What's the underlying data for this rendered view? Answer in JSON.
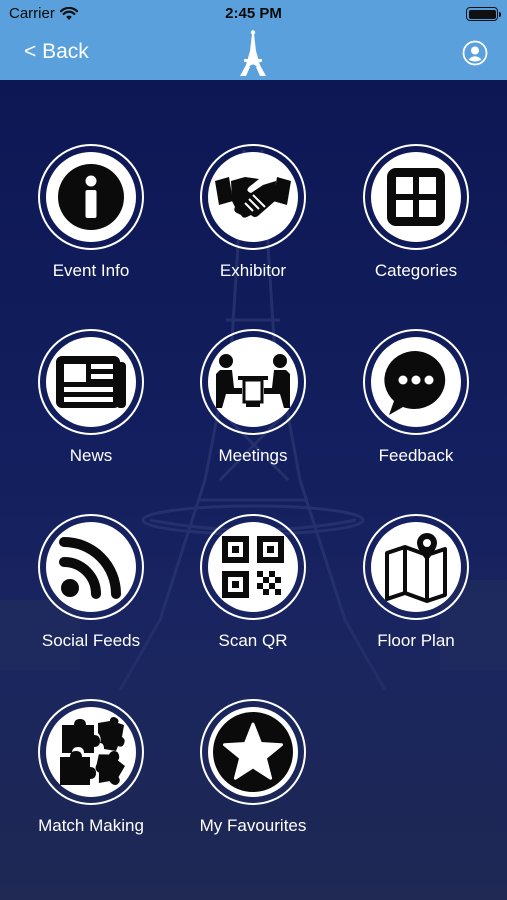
{
  "status_bar": {
    "carrier": "Carrier",
    "time": "2:45 PM",
    "battery_level": 1.0
  },
  "nav": {
    "back_label": "< Back",
    "logo_icon": "eiffel-tower-logo",
    "profile_icon": "user-circle-icon"
  },
  "menu": {
    "items": [
      {
        "label": "Event Info",
        "icon": "info-icon"
      },
      {
        "label": "Exhibitor",
        "icon": "handshake-icon"
      },
      {
        "label": "Categories",
        "icon": "grid-icon"
      },
      {
        "label": "News",
        "icon": "newspaper-icon"
      },
      {
        "label": "Meetings",
        "icon": "meeting-icon"
      },
      {
        "label": "Feedback",
        "icon": "chat-bubble-icon"
      },
      {
        "label": "Social Feeds",
        "icon": "rss-icon"
      },
      {
        "label": "Scan QR",
        "icon": "qr-code-icon"
      },
      {
        "label": "Floor Plan",
        "icon": "map-pin-icon"
      },
      {
        "label": "Match Making",
        "icon": "puzzle-icon"
      },
      {
        "label": "My Favourites",
        "icon": "star-icon"
      }
    ]
  },
  "colors": {
    "header": "#5aa0dc",
    "background": "#0e1a4e",
    "icon_fill": "#0b0b0b",
    "icon_circle": "#ffffff"
  }
}
